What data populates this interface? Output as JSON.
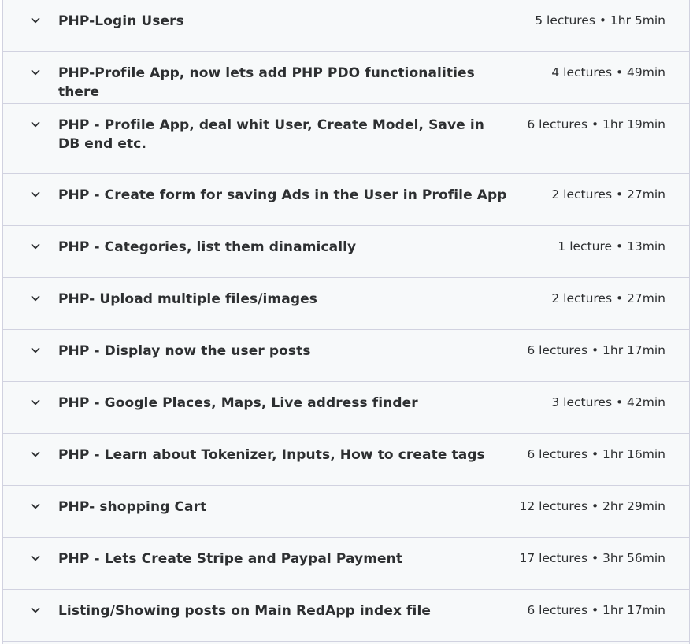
{
  "sections": [
    {
      "title": "PHP-Login Users",
      "meta": "5 lectures • 1hr 5min"
    },
    {
      "title": "PHP-Profile App, now lets add PHP PDO functionalities there",
      "meta": "4 lectures • 49min"
    },
    {
      "title": "PHP - Profile App, deal whit User, Create Model, Save in DB end etc.",
      "meta": "6 lectures • 1hr 19min"
    },
    {
      "title": "PHP - Create form for saving Ads in the User in Profile App",
      "meta": "2 lectures • 27min"
    },
    {
      "title": "PHP - Categories, list them dinamically",
      "meta": "1 lecture • 13min"
    },
    {
      "title": "PHP- Upload multiple files/images",
      "meta": "2 lectures • 27min"
    },
    {
      "title": "PHP - Display now the user posts",
      "meta": "6 lectures • 1hr 17min"
    },
    {
      "title": "PHP - Google Places, Maps, Live address finder",
      "meta": "3 lectures • 42min"
    },
    {
      "title": "PHP - Learn about Tokenizer, Inputs, How to create tags",
      "meta": "6 lectures • 1hr 16min"
    },
    {
      "title": "PHP- shopping Cart",
      "meta": "12 lectures • 2hr 29min"
    },
    {
      "title": "PHP - Lets Create Stripe and Paypal Payment",
      "meta": "17 lectures • 3hr 56min"
    },
    {
      "title": "Listing/Showing posts on Main RedApp index file",
      "meta": "6 lectures • 1hr 17min"
    }
  ],
  "icons": {
    "toggle": "chevron-down-icon"
  },
  "colors": {
    "text": "#2d2f31",
    "background": "#f7f9fa",
    "border": "#d1d2e0"
  }
}
